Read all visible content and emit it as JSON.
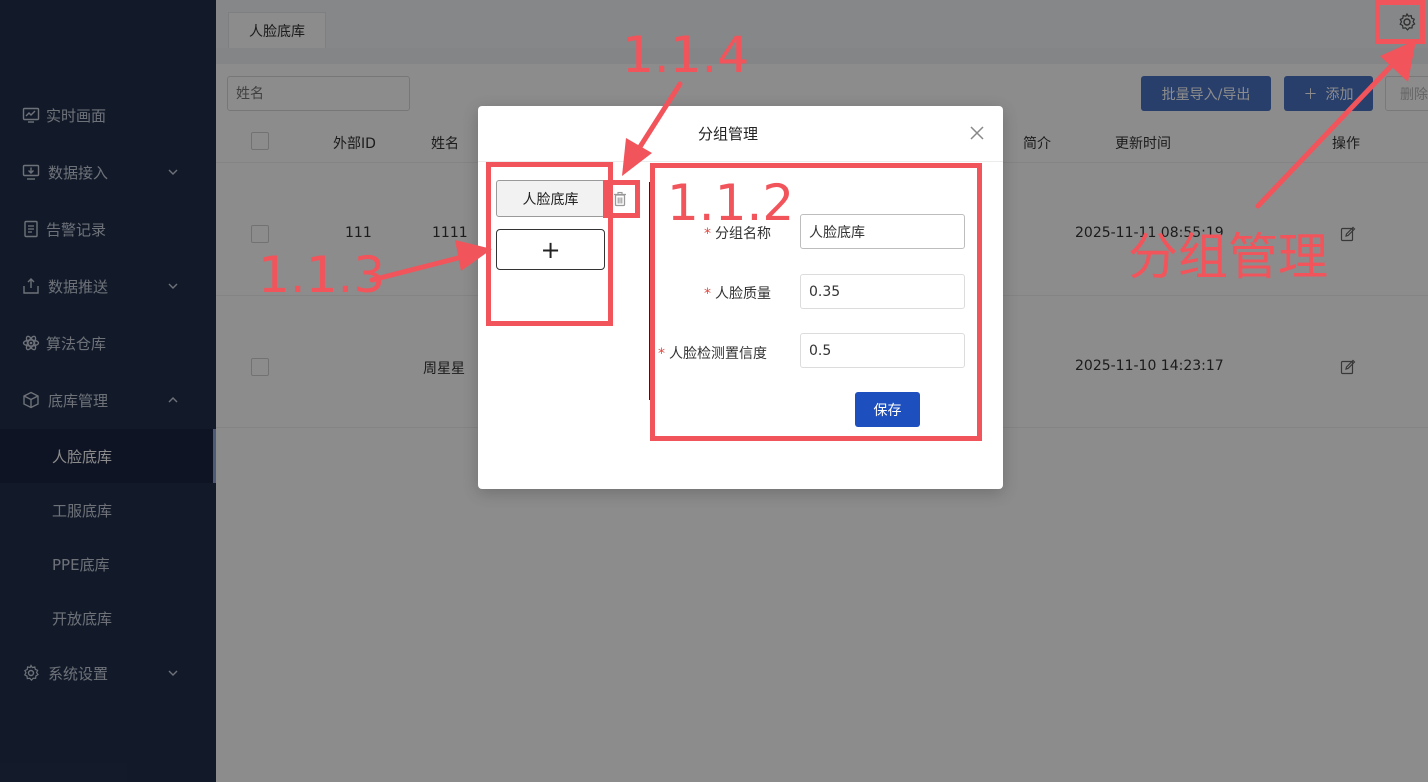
{
  "sidebar": {
    "items": [
      {
        "label": "实时画面",
        "icon": "monitor-chart-icon",
        "expandable": false
      },
      {
        "label": "数据接入",
        "icon": "data-input-icon",
        "expandable": true
      },
      {
        "label": "告警记录",
        "icon": "document-icon",
        "expandable": false
      },
      {
        "label": "数据推送",
        "icon": "upload-tray-icon",
        "expandable": true
      },
      {
        "label": "算法仓库",
        "icon": "atom-icon",
        "expandable": false
      },
      {
        "label": "底库管理",
        "icon": "cube-icon",
        "expandable": true,
        "expanded": true
      },
      {
        "label": "系统设置",
        "icon": "gear-icon",
        "expandable": true
      }
    ],
    "sub_items": [
      {
        "label": "人脸底库",
        "active": true
      },
      {
        "label": "工服底库",
        "active": false
      },
      {
        "label": "PPE底库",
        "active": false
      },
      {
        "label": "开放底库",
        "active": false
      }
    ]
  },
  "header": {
    "tab_label": "人脸底库"
  },
  "toolbar": {
    "search_placeholder": "姓名",
    "import_label": "批量导入/导出",
    "add_label": "添加",
    "delete_label": "删除"
  },
  "table": {
    "columns": [
      "外部ID",
      "姓名",
      "简介",
      "更新时间",
      "操作"
    ],
    "rows": [
      {
        "external_id": "111",
        "name": "1111",
        "intro": "",
        "updated": "2025-11-11 08:55:19"
      },
      {
        "external_id": "",
        "name": "周星星",
        "intro": "",
        "updated": "2025-11-10 14:23:17"
      }
    ]
  },
  "modal": {
    "title": "分组管理",
    "groups": [
      "人脸底库"
    ],
    "add_group_symbol": "+",
    "form": {
      "group_name_label": "分组名称",
      "group_name_value": "人脸底库",
      "face_quality_label": "人脸质量",
      "face_quality_value": "0.35",
      "detect_confidence_label": "人脸检测置信度",
      "detect_confidence_value": "0.5",
      "required_mark": "*",
      "save_label": "保存"
    }
  },
  "annotations": {
    "label_114": "1.1.4",
    "label_112": "1.1.2",
    "label_113": "1.1.3",
    "label_group_mgmt": "分组管理",
    "color": "#f2545b"
  },
  "colors": {
    "sidebar_bg": "#22304d",
    "primary": "#4a72c4",
    "save_button": "#1e4fbf",
    "annotation": "#f2545b"
  }
}
